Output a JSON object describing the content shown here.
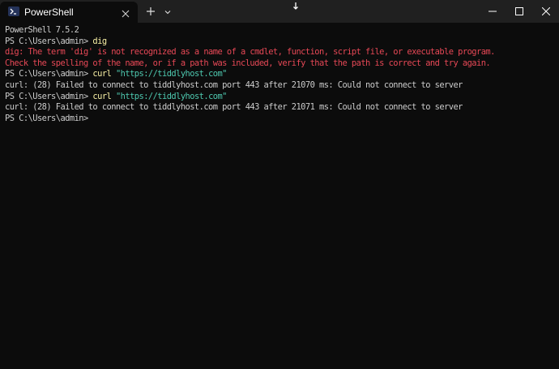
{
  "window": {
    "tab_title": "PowerShell",
    "tab_icon": "powershell-icon",
    "controls": [
      "minimize-icon",
      "maximize-icon",
      "close-icon"
    ],
    "colors": {
      "titlebar": "#202020",
      "background": "#0c0c0c",
      "foreground": "#cccccc",
      "error": "#e74856",
      "command": "#f9f1a5",
      "string": "#4ec9b0"
    }
  },
  "terminal": {
    "version_line": "PowerShell 7.5.2",
    "prompt": "PS C:\\Users\\admin> ",
    "cmd1": "dig",
    "err1": "dig: The term 'dig' is not recognized as a name of a cmdlet, function, script file, or executable program.",
    "err2": "Check the spelling of the name, or if a path was included, verify that the path is correct and try again.",
    "cmd2": "curl",
    "arg2": " \"https://tiddlyhost.com\"",
    "out2": "curl: (28) Failed to connect to tiddlyhost.com port 443 after 21070 ms: Could not connect to server",
    "cmd3": "curl",
    "arg3": " \"https://tiddlyhost.com\"",
    "out3": "curl: (28) Failed to connect to tiddlyhost.com port 443 after 21071 ms: Could not connect to server"
  }
}
